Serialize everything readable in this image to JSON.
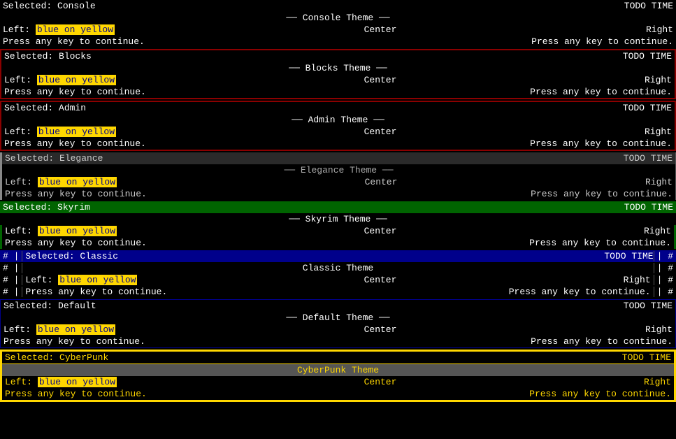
{
  "themes": [
    {
      "id": "console",
      "selected_label": "Selected: Console",
      "todo_label": "TODO TIME",
      "title": "Console Theme",
      "left_text": "Left:",
      "highlight_text": "blue on yellow",
      "center_text": "Center",
      "right_text": "Right",
      "press_text": "Press any key to continue.",
      "press_right": "Press any key to continue.",
      "style": "console"
    },
    {
      "id": "blocks",
      "selected_label": "Selected: Blocks",
      "todo_label": "TODO TIME",
      "title": "Blocks Theme",
      "left_text": "Left:",
      "highlight_text": "blue on yellow",
      "center_text": "Center",
      "right_text": "Right",
      "press_text": "Press any key to continue.",
      "press_right": "Press any key to continue.",
      "style": "blocks"
    },
    {
      "id": "admin",
      "selected_label": "Selected: Admin",
      "todo_label": "TODO TIME",
      "title": "Admin Theme",
      "left_text": "Left:",
      "highlight_text": "blue on yellow",
      "center_text": "Center",
      "right_text": "Right",
      "press_text": "Press any key to continue.",
      "press_right": "Press any key to continue.",
      "style": "admin"
    },
    {
      "id": "elegance",
      "selected_label": "Selected: Elegance",
      "todo_label": "TODO TIME",
      "title": "Elegance Theme",
      "left_text": "Left:",
      "highlight_text": "blue on yellow",
      "center_text": "Center",
      "right_text": "Right",
      "press_text": "Press any key to continue.",
      "press_right": "Press any key to continue.",
      "style": "elegance"
    },
    {
      "id": "skyrim",
      "selected_label": "Selected: Skyrim",
      "todo_label": "TODO TIME",
      "title": "Skyrim Theme",
      "left_text": "Left:",
      "highlight_text": "blue on yellow",
      "center_text": "Center",
      "right_text": "Right",
      "press_text": "Press any key to continue.",
      "press_right": "Press any key to continue.",
      "style": "skyrim"
    },
    {
      "id": "classic",
      "selected_label": "Selected: Classic",
      "todo_label": "TODO TIME",
      "title": "Classic Theme",
      "left_text": "Left:",
      "highlight_text": "blue on yellow",
      "center_text": "Center",
      "right_text": "Right",
      "press_text": "Press any key to continue.",
      "press_right": "Press any key to continue.",
      "style": "classic"
    },
    {
      "id": "default",
      "selected_label": "Selected: Default",
      "todo_label": "TODO TIME",
      "title": "Default Theme",
      "left_text": "Left:",
      "highlight_text": "blue on yellow",
      "center_text": "Center",
      "right_text": "Right",
      "press_text": "Press any key to continue.",
      "press_right": "Press any key to continue.",
      "style": "default"
    },
    {
      "id": "cyberpunk",
      "selected_label": "Selected: CyberPunk",
      "todo_label": "TODO TIME",
      "title": "CyberPunk Theme",
      "left_text": "Left:",
      "highlight_text": "blue on yellow",
      "center_text": "Center",
      "right_text": "Right",
      "press_text": "Press any key to continue.",
      "press_right": "Press any key to continue.",
      "style": "cyberpunk"
    }
  ],
  "press_label": "Press"
}
